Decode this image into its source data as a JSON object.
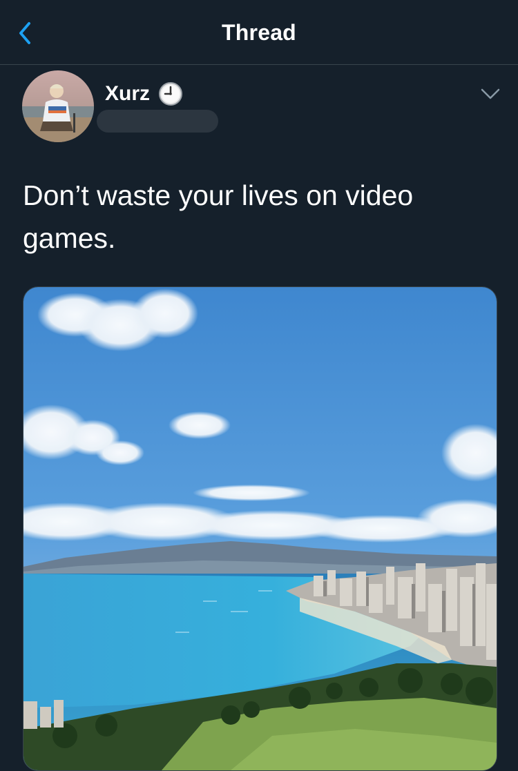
{
  "nav": {
    "title": "Thread",
    "back_icon": "chevron-left-icon",
    "accent_color": "#1da1f2"
  },
  "tweet": {
    "author": {
      "display_name": "Xurz",
      "status_icon": "clock-icon"
    },
    "menu_icon": "chevron-down-icon",
    "text": "Don’t waste your lives on video games.",
    "media_description_icon": "landscape-photo"
  },
  "theme": {
    "background": "#15202b",
    "divider": "#38444d",
    "text_primary": "#ffffff",
    "text_secondary": "#8899a6"
  }
}
